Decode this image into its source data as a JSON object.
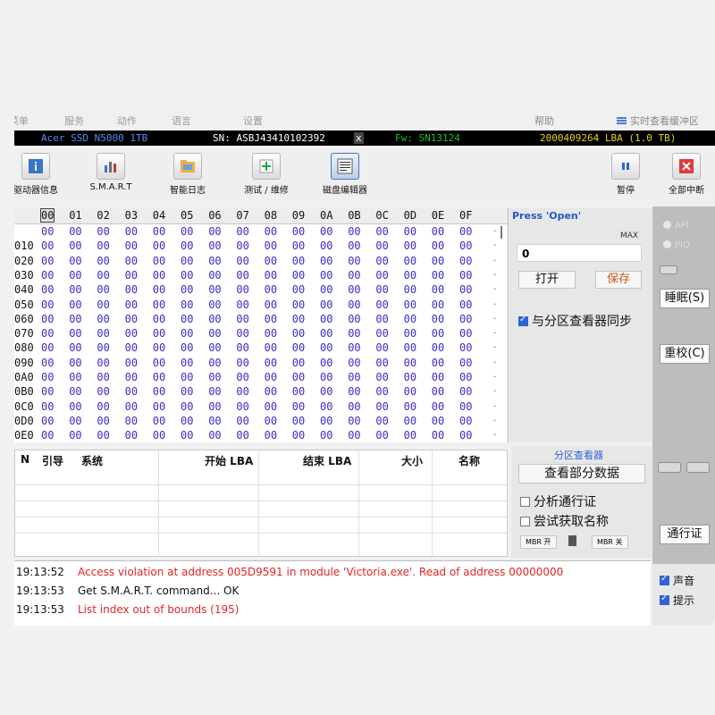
{
  "menu": {
    "items": [
      "菜单",
      "服务",
      "动作",
      "语言",
      "设置"
    ],
    "help": "帮助",
    "buffer": "实时查看缓冲区"
  },
  "drive": {
    "model": "Acer SSD N5000 1TB",
    "serial": "SN: ASBJ43410102392",
    "close": "x",
    "firmware": "Fw: SN13124",
    "lba": "2000409264 LBA (1.0 TB)"
  },
  "toolbar": {
    "drive_info": "驱动器信息",
    "smart": "S.M.A.R.T",
    "smart_log": "智能日志",
    "test": "测试 / 维修",
    "disk_editor": "磁盘编辑器",
    "pause": "暂停",
    "break_all": "全部中断"
  },
  "hex": {
    "columns": [
      "00",
      "01",
      "02",
      "03",
      "04",
      "05",
      "06",
      "07",
      "08",
      "09",
      "0A",
      "0B",
      "0C",
      "0D",
      "0E",
      "0F"
    ],
    "addresses": [
      "",
      "010",
      "020",
      "030",
      "040",
      "050",
      "060",
      "070",
      "080",
      "090",
      "0A0",
      "0B0",
      "0C0",
      "0D0",
      "0E0"
    ],
    "byte": "00",
    "ascii": "."
  },
  "editor": {
    "press_open": "Press 'Open'",
    "max": "MAX",
    "value": "0",
    "open": "打开",
    "save": "保存",
    "sync": "与分区查看器同步"
  },
  "side": {
    "api": "API",
    "pio": "PIO",
    "sleep": "睡眠(S)",
    "recal": "重校(C)",
    "passport": "通行证"
  },
  "partitions": {
    "headers": [
      "N",
      "引导",
      "系统",
      "开始 LBA",
      "结束 LBA",
      "大小",
      "名称"
    ]
  },
  "partition_viewer": {
    "title": "分区查看器",
    "view_button": "查看部分数据",
    "analyze": "分析通行证",
    "try_name": "尝试获取名称",
    "mbr_on": "MBR 开",
    "mbr_off": "MBR 关"
  },
  "log": [
    {
      "time": "19:13:52",
      "text": "Access violation at address 005D9591 in module 'Victoria.exe'. Read of address 00000000",
      "color": "#e02525"
    },
    {
      "time": "19:13:53",
      "text": "Get S.M.A.R.T. command... OK",
      "color": "#111111"
    },
    {
      "time": "19:13:53",
      "text": "List index out of bounds (195)",
      "color": "#e02525"
    }
  ],
  "log_options": {
    "sound": "声音",
    "hints": "提示"
  }
}
